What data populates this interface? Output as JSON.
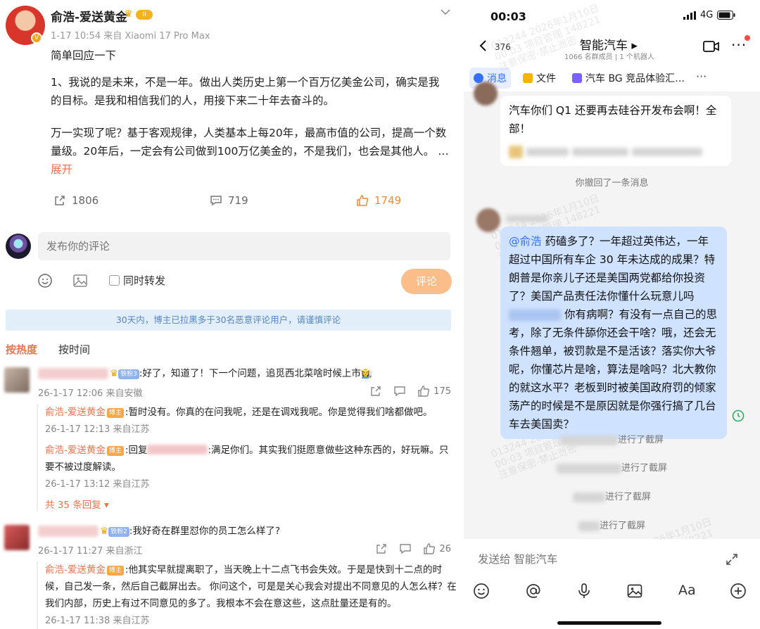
{
  "post": {
    "author": "俞浩-爱送黄金",
    "level_badge": "II",
    "verified_badge": "V",
    "meta": "1-17 10:54 来自 Xiaomi 17 Pro Max",
    "intro": "简单回应一下",
    "para1": "1、我说的是未来，不是一年。做出人类历史上第一个百万亿美金公司，确实是我的目标。是我和相信我们的人，用接下来二十年去奋斗的。",
    "para2": "万一实现了呢？基于客观规律，人类基本上每20年，最高市值的公司，提高一个数量级。20年后，一定会有公司做到100万亿美金的，不是我们，也会是其他人。 … ",
    "expand": "展开",
    "reposts": "1806",
    "comments": "719",
    "likes": "1749"
  },
  "compose": {
    "placeholder": "发布你的评论",
    "repost_label": "同时转发",
    "submit": "评论"
  },
  "notice": "30天内，博主已拉黑多于30名恶意评论用户，请谨慎评论",
  "sort": {
    "hot": "按热度",
    "time": "按时间"
  },
  "comments": [
    {
      "badge": "铁粉3",
      "text": ":好了，知道了！下一个问题，追觅西北菜啥时候上市👩‍🌾",
      "meta": "26-1-17 12:06 来自安徽",
      "likes": "175",
      "replies": [
        {
          "name": "俞浩-爱送黄金",
          "host": "博主",
          "text": ":暂时没有。你真的在问我呢，还是在调戏我呢。你是觉得我们啥都做吧。",
          "meta": "26-1-17 12:13 来自江苏"
        },
        {
          "name": "俞浩-爱送黄金",
          "host": "博主",
          "pre": ":回复",
          "text": ":满足你们。其实我们挺愿意做些这种东西的，好玩嘛。只要不被过度解读。",
          "meta": "26-1-17 13:12 来自江苏"
        }
      ],
      "more": "共 35 条回复 ▾"
    },
    {
      "badge": "铁粉2",
      "text": ":我好奇在群里怼你的员工怎么样了?",
      "meta": "26-1-17 11:27 来自浙江",
      "likes": "26",
      "replies": [
        {
          "name": "俞浩-爱送黄金",
          "host": "博主",
          "text": ":他其实早就提离职了，当天晚上十二点飞书会失效。于是是快到十二点的时候，自己发一条，然后自己截屏出去。 你问这个，可是是关心我会对提出不同意见的人怎么样？在我们内部，历史上有过不同意见的多了。我根本不会在意这些，这点肚量还是有的。",
          "meta": "26-1-17 11:38 来自江苏"
        }
      ]
    }
  ],
  "chat": {
    "status_time": "00:03",
    "network": "4G",
    "unread": "376",
    "group_name": "智能汽车 ▸",
    "group_sub": "1066 名群成员  |  1 个机器人",
    "tabs": [
      "消息",
      "文件",
      "汽车 BG 竞品体验汇…",
      "···"
    ],
    "msg1": "汽车你们 Q1 还要再去硅谷开发布会啊！全部！",
    "recalled": "你撤回了一条消息",
    "mention": "@俞浩",
    "msg2_a": " 药磕多了？一年超过英伟达，一年超过中国所有车企 30 年未达成的成果？特朗普是你亲儿子还是美国两党都给你投资了？美国产品责任法你懂什么玩意儿吗",
    "msg2_b": "你有病啊？有没有一点自己的思考，除了无条件舔你还会干啥？哦，还会无条件翘单，被罚款是不是活该？落实你大爷呢，你懂芯片是啥，算法是啥吗？北大教你的就这水平？老板到时被美国政府罚的倾家荡产的时候是不是原因就是你强行搞了几台车去美国卖？",
    "screenshot": "进行了截屏",
    "input_placeholder": "发送给 智能汽车",
    "font_btn": "Aa",
    "watermark_l1": "013244 2026年1月10日",
    "watermark_l2": "00:03 项目管理 148221",
    "watermark_l3": "注意保密-禁止泄密"
  }
}
